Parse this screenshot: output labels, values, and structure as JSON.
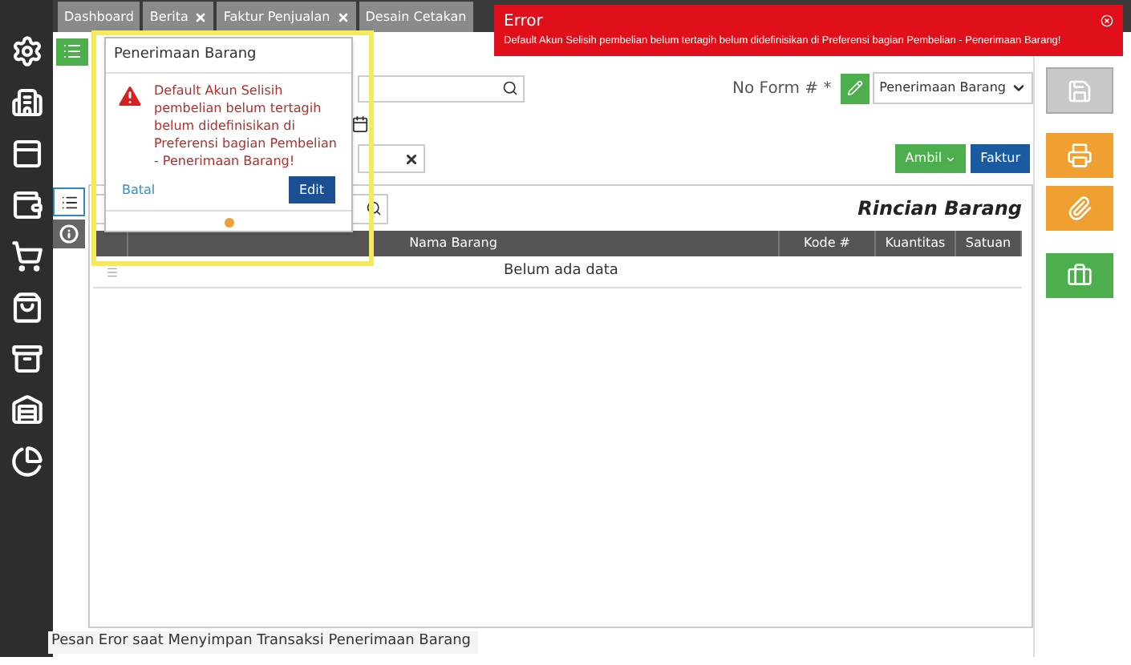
{
  "tabs": [
    {
      "label": "Dashboard",
      "closable": false,
      "selected": false
    },
    {
      "label": "Berita",
      "closable": true,
      "selected": false
    },
    {
      "label": "Faktur Penjualan",
      "closable": true,
      "selected": false
    },
    {
      "label": "Desain Cetakan",
      "closable": false,
      "selected": false
    }
  ],
  "form": {
    "form_no_label": "No Form # *",
    "form_type": "Penerimaan Barang",
    "buttons": [
      {
        "label": "Ambil",
        "kind": "dropdown"
      },
      {
        "label": "Faktur",
        "kind": "plain"
      }
    ]
  },
  "items_table": {
    "title": "Rincian Barang",
    "columns": [
      "Nama Barang",
      "Kode #",
      "Kuantitas",
      "Satuan"
    ],
    "empty_text": "Belum ada data"
  },
  "error_toast": {
    "title": "Error",
    "message": "Default Akun Selisih pembelian belum tertagih belum didefinisikan di Preferensi bagian Pembelian - Penerimaan Barang!"
  },
  "dialog": {
    "title": "Penerimaan Barang",
    "message": "Default Akun Selisih pembelian belum tertagih belum didefinisikan di Preferensi bagian Pembelian - Penerimaan Barang!",
    "cancel": "Batal",
    "confirm": "Edit"
  },
  "caption": "Pesan Eror saat Menyimpan Transaksi Penerimaan Barang"
}
